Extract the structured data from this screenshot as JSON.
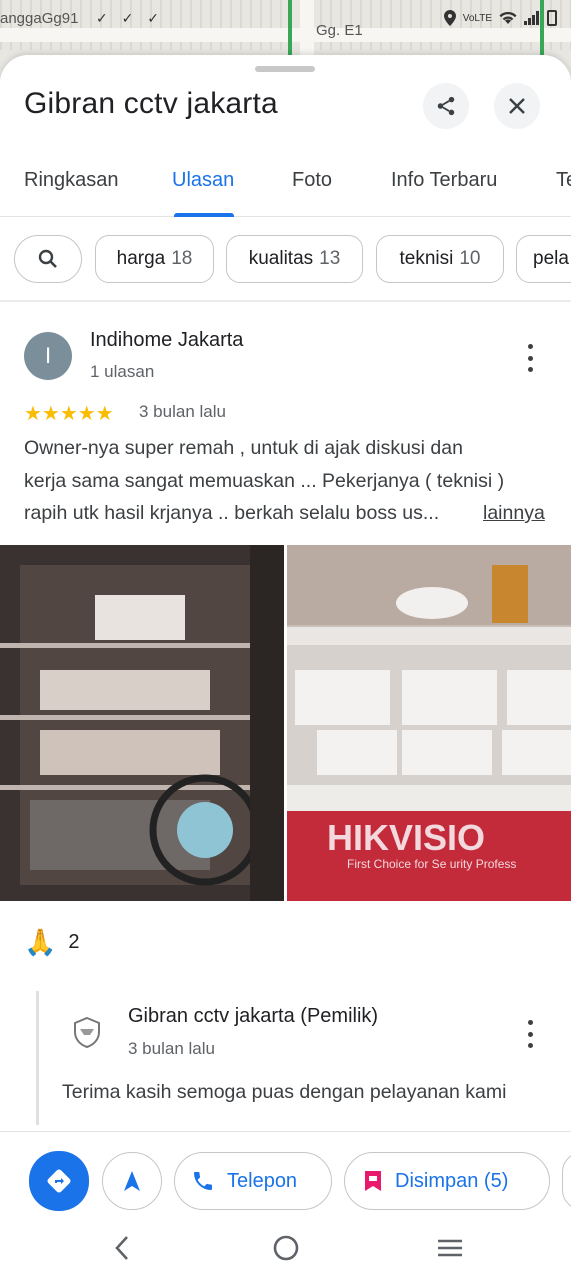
{
  "status_bar": {
    "map_label_left": "anggaGg91",
    "map_label_street": "Gg. E1",
    "icons": [
      "location-icon",
      "volte-icon",
      "wifi-icon",
      "signal-icon",
      "battery-icon"
    ]
  },
  "place": {
    "title": "Gibran cctv jakarta"
  },
  "tabs": [
    {
      "label": "Ringkasan",
      "active": false
    },
    {
      "label": "Ulasan",
      "active": true
    },
    {
      "label": "Foto",
      "active": false
    },
    {
      "label": "Info Terbaru",
      "active": false
    },
    {
      "label": "Te",
      "active": false
    }
  ],
  "chips": [
    {
      "label": "harga",
      "count": "18"
    },
    {
      "label": "kualitas",
      "count": "13"
    },
    {
      "label": "teknisi",
      "count": "10"
    },
    {
      "label": "pela",
      "count": ""
    }
  ],
  "review": {
    "avatar_letter": "I",
    "author": "Indihome Jakarta",
    "author_meta": "1 ulasan",
    "rating": 5,
    "stars": "★★★★★",
    "time": "3 bulan lalu",
    "text_line1": "Owner-nya super remah , untuk di ajak diskusi dan",
    "text_line2": "kerja sama sangat memuaskan ... Pekerjanya ( teknisi )",
    "text_line3": "rapih utk hasil krjanya .. berkah selalu boss us...",
    "more_link": "lainnya",
    "reaction_count": "2"
  },
  "owner_reply": {
    "name": "Gibran cctv jakarta (Pemilik)",
    "time": "3 bulan lalu",
    "text": "Terima kasih semoga puas dengan pelayanan kami"
  },
  "photos": {
    "photo2_banner": "HIKVISIO",
    "photo2_tagline": "First Choice for Se   urity Profess"
  },
  "actions": {
    "phone_label": "Telepon",
    "saved_label": "Disimpan (5)"
  },
  "colors": {
    "accent": "#1a73e8",
    "star": "#fbbc04",
    "avatar": "#7b8f9a",
    "saved_icon": "#e8196d"
  }
}
